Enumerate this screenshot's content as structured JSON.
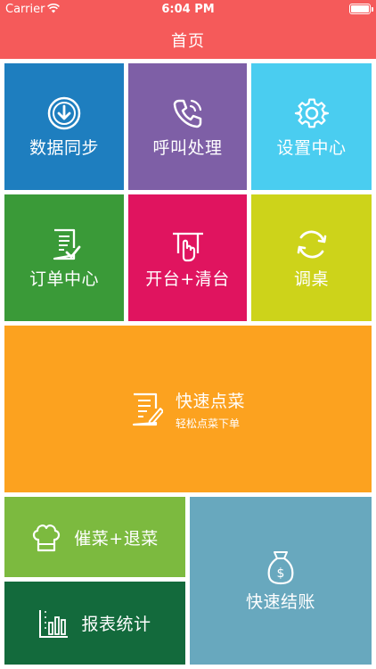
{
  "status_bar": {
    "carrier": "Carrier",
    "time": "6:04 PM"
  },
  "header": {
    "title": "首页"
  },
  "tiles": {
    "data_sync": {
      "label": "数据同步",
      "icon": "download-circle-icon",
      "color": "#1e7ebf"
    },
    "call_handling": {
      "label": "呼叫处理",
      "icon": "phone-icon",
      "color": "#7e5fa6"
    },
    "settings": {
      "label": "设置中心",
      "icon": "gear-icon",
      "color": "#4acdf0"
    },
    "order_center": {
      "label": "订单中心",
      "icon": "document-check-icon",
      "color": "#3a9a38"
    },
    "open_clear_table": {
      "label": "开台+清台",
      "icon": "hand-icon",
      "color": "#e0145f"
    },
    "change_table": {
      "label": "调桌",
      "icon": "refresh-icon",
      "color": "#cdd31a"
    },
    "quick_order": {
      "label": "快速点菜",
      "subtitle": "轻松点菜下单",
      "icon": "edit-document-icon",
      "color": "#fca21f"
    },
    "rush_return": {
      "label": "催菜+退菜",
      "icon": "chef-hat-icon",
      "color": "#7cba3f"
    },
    "reports": {
      "label": "报表统计",
      "icon": "bar-chart-icon",
      "color": "#136a3c"
    },
    "quick_checkout": {
      "label": "快速结账",
      "icon": "money-bag-icon",
      "color": "#68a8be"
    }
  }
}
